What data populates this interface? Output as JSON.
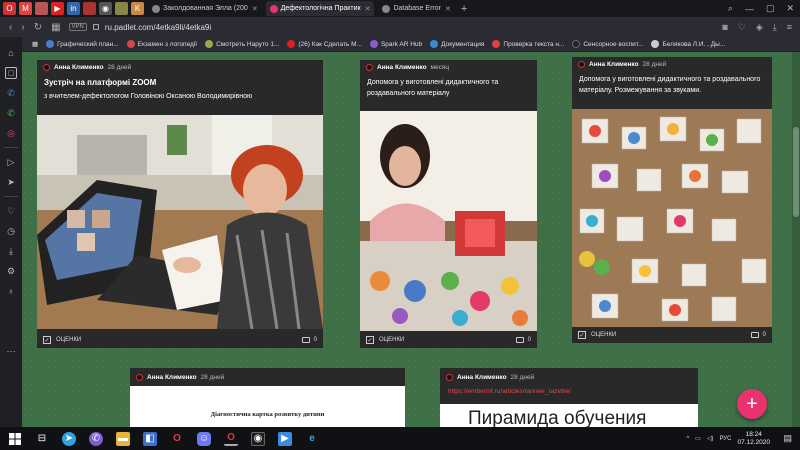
{
  "browser": {
    "tabs": [
      {
        "label": "Заколдованная Элла (200",
        "active": false
      },
      {
        "label": "Дефектологічна Практик",
        "active": true
      },
      {
        "label": "Database Error",
        "active": false
      }
    ],
    "url": "ru.padlet.com/4etka9li/4etka9i",
    "vpn_label": "VPN",
    "bookmarks": [
      {
        "label": "Графический план...",
        "color": "#4a7bd0"
      },
      {
        "label": "Екзамен з логопедії",
        "color": "#d04a4a"
      },
      {
        "label": "Смотреть Наруто 1...",
        "color": "#9aa74a"
      },
      {
        "label": "(26) Как Сделать М...",
        "color": "#e02020"
      },
      {
        "label": "Spark AR Hub",
        "color": "#8a5cd0"
      },
      {
        "label": "Документация",
        "color": "#3a8ad0"
      },
      {
        "label": "Проверка текста н...",
        "color": "#e04040"
      },
      {
        "label": "Сенсорное воспит...",
        "color": "#222222"
      },
      {
        "label": "Белякова Л.И. , Ды...",
        "color": "#cccccc"
      }
    ]
  },
  "cards": [
    {
      "author": "Анна Клименко",
      "time": "28 дней",
      "title": "Зустріч на платформі ZOOM",
      "desc": "з вчителем-дефектологом Головіною Оксаною Володимирівною",
      "ratings": "ОЦЕНКИ",
      "comments": "0"
    },
    {
      "author": "Анна Клименко",
      "time": "месяц",
      "title": "Допомога у виготовлені дидактичного та роздавального матеріалу",
      "ratings": "ОЦЕНКИ",
      "comments": "0"
    },
    {
      "author": "Анна Клименко",
      "time": "28 дней",
      "title": "Допомога у виготовлені дидактичного та роздавального матеріалу. Розмежування за звуками.",
      "ratings": "ОЦЕНКИ",
      "comments": "0"
    },
    {
      "author": "Анна Клименко",
      "time": "28 дней",
      "doc_title": "Діагностична картка розвитку дитини"
    },
    {
      "author": "Анна Клименко",
      "time": "28 дней",
      "link": "https://emberinf.ru/articles/rannee_razvitie/",
      "preview_text": "Пирамида обучения"
    }
  ],
  "fab_label": "+",
  "taskbar": {
    "lang": "РУС",
    "time": "18:24",
    "date": "07.12.2020"
  }
}
